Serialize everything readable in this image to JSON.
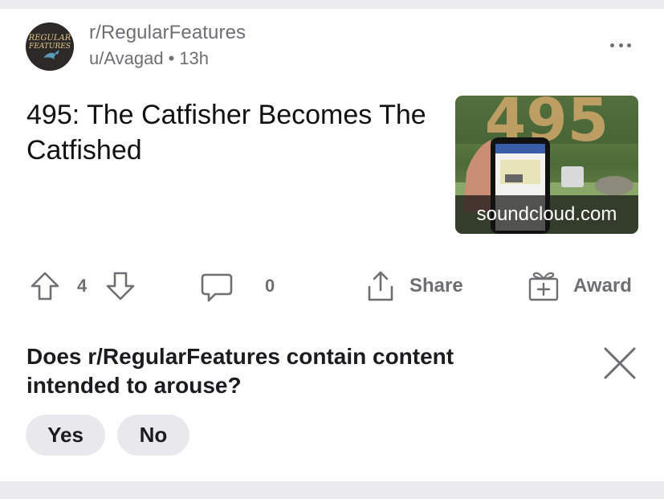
{
  "post": {
    "subreddit": "r/RegularFeatures",
    "author": "u/Avagad",
    "separator": "•",
    "age": "13h",
    "title": "495: The Catfisher Becomes The Catfished",
    "thumbnail": {
      "domain": "soundcloud.com",
      "overlay_number": "495"
    },
    "avatar_text": [
      "REGULAR",
      "FEATURES"
    ]
  },
  "actions": {
    "upvote_icon": "arrow-up-icon",
    "vote_count": "4",
    "downvote_icon": "arrow-down-icon",
    "comment_icon": "speech-bubble-icon",
    "comment_count": "0",
    "share_icon": "share-upload-icon",
    "share_label": "Share",
    "award_icon": "gift-award-icon",
    "award_label": "Award"
  },
  "survey": {
    "question": "Does r/RegularFeatures contain content intended to arouse?",
    "yes_label": "Yes",
    "no_label": "No",
    "close_icon": "close-x-icon"
  },
  "colors": {
    "muted_text": "#6e6e73",
    "pill_bg": "#e9e9ed",
    "band_bg": "#ececf0"
  }
}
